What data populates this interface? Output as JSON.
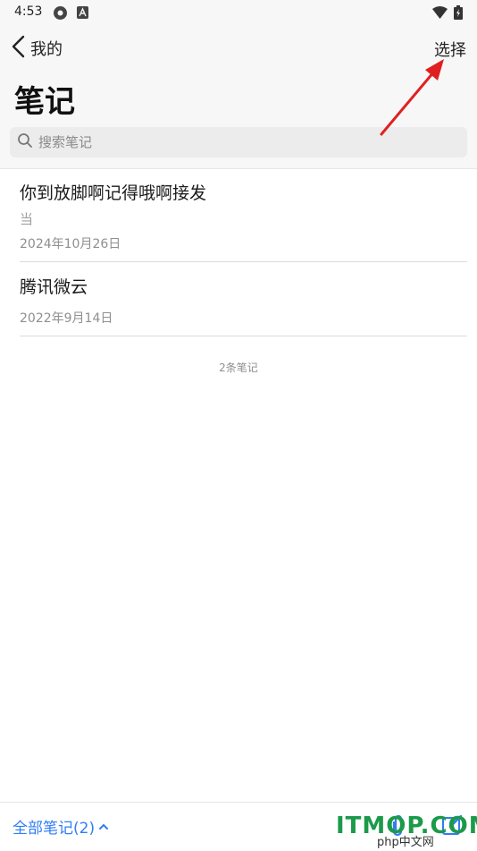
{
  "status_bar": {
    "time": "4:53"
  },
  "header": {
    "back_label": "我的",
    "select_label": "选择",
    "title": "笔记"
  },
  "search": {
    "placeholder": "搜索笔记"
  },
  "notes": [
    {
      "title": "你到放脚啊记得哦啊接发",
      "preview": "当",
      "date": "2024年10月26日"
    },
    {
      "title": "腾讯微云",
      "date": "2022年9月14日"
    }
  ],
  "note_count": "2条笔记",
  "bottom_bar": {
    "all_notes_label": "全部笔记(2)"
  },
  "watermark": {
    "brand": "ITMOP.COM",
    "sub": "php中文网"
  },
  "colors": {
    "accent": "#2f7df6",
    "annotation_arrow": "#e02020",
    "watermark": "#1c9a4a"
  },
  "icons": {
    "back": "chevron-left-icon",
    "search": "search-icon",
    "attach": "paperclip-icon",
    "compose": "compose-icon",
    "all_notes_toggle": "chevron-up-icon"
  }
}
